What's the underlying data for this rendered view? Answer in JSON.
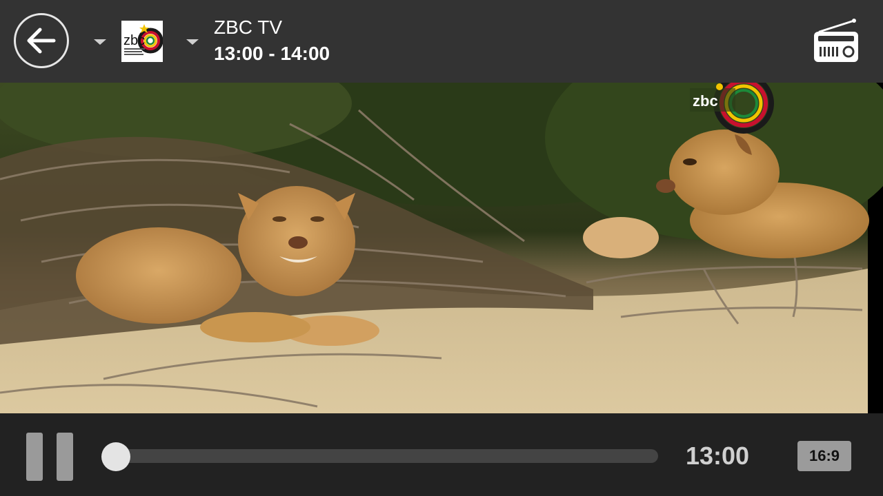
{
  "header": {
    "channel_name": "ZBC TV",
    "time_slot": "13:00 - 14:00",
    "logo_text": "zbc",
    "icons": {
      "back": "arrow-left-icon",
      "channel_dropdown": "chevron-down-icon",
      "program_dropdown": "chevron-down-icon",
      "radio": "radio-icon"
    }
  },
  "video": {
    "watermark_text": "zbc"
  },
  "controls": {
    "current_time": "13:00",
    "aspect_ratio": "16:9",
    "progress": 0.0,
    "icons": {
      "play_pause": "pause-icon"
    }
  },
  "colors": {
    "topbar": "#333333",
    "bottombar": "#222222",
    "track": "#444444",
    "thumb": "#e4e4e4"
  }
}
